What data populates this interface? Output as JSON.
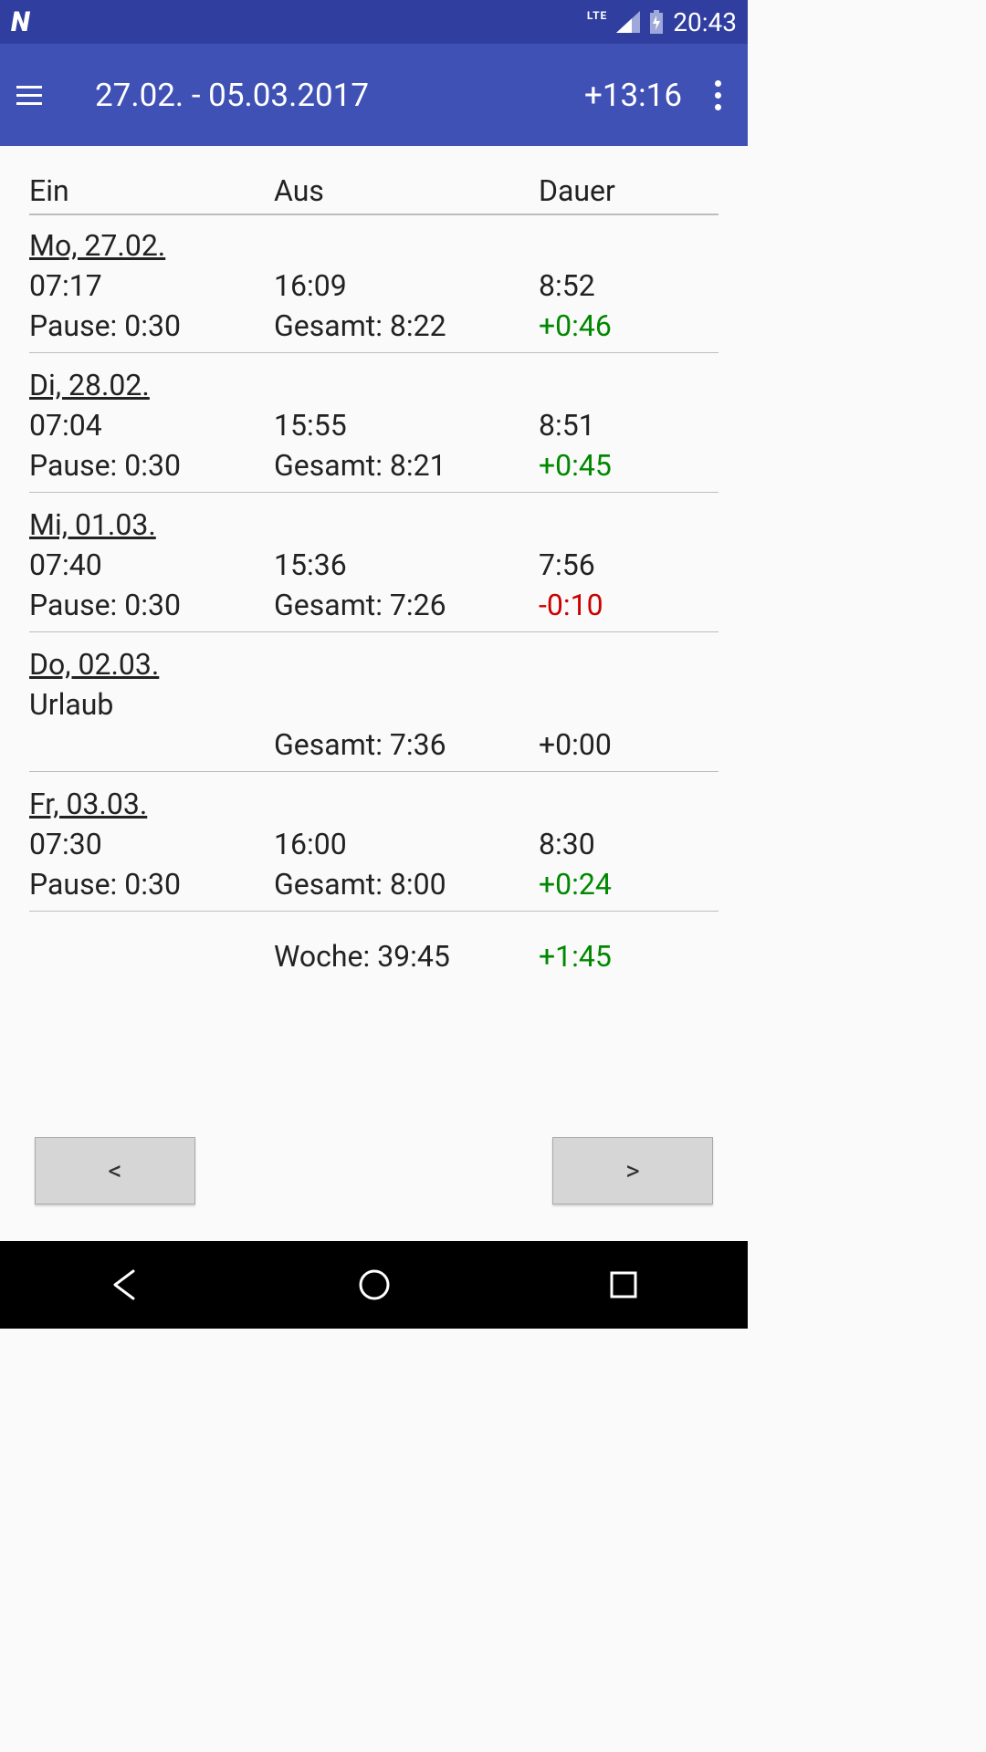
{
  "status": {
    "time": "20:43",
    "network": "LTE"
  },
  "appbar": {
    "title": "27.02. - 05.03.2017",
    "balance": "+13:16"
  },
  "headers": {
    "ein": "Ein",
    "aus": "Aus",
    "dauer": "Dauer"
  },
  "entries": [
    {
      "date": "Mo, 27.02.",
      "ein": "07:17",
      "aus": "16:09",
      "dauer": "8:52",
      "pause": "Pause: 0:30",
      "gesamt": "Gesamt: 8:22",
      "diff": "+0:46",
      "diff_kind": "pos"
    },
    {
      "date": "Di, 28.02.",
      "ein": "07:04",
      "aus": "15:55",
      "dauer": "8:51",
      "pause": "Pause: 0:30",
      "gesamt": "Gesamt: 8:21",
      "diff": "+0:45",
      "diff_kind": "pos"
    },
    {
      "date": "Mi, 01.03.",
      "ein": "07:40",
      "aus": "15:36",
      "dauer": "7:56",
      "pause": "Pause: 0:30",
      "gesamt": "Gesamt: 7:26",
      "diff": "-0:10",
      "diff_kind": "neg"
    },
    {
      "date": "Do, 02.03.",
      "note": "Urlaub",
      "gesamt": "Gesamt: 7:36",
      "diff": "+0:00",
      "diff_kind": "neutral"
    },
    {
      "date": "Fr, 03.03.",
      "ein": "07:30",
      "aus": "16:00",
      "dauer": "8:30",
      "pause": "Pause: 0:30",
      "gesamt": "Gesamt: 8:00",
      "diff": "+0:24",
      "diff_kind": "pos"
    }
  ],
  "week": {
    "label": "Woche: 39:45",
    "diff": "+1:45",
    "diff_kind": "pos"
  },
  "nav": {
    "prev": "<",
    "next": ">"
  }
}
